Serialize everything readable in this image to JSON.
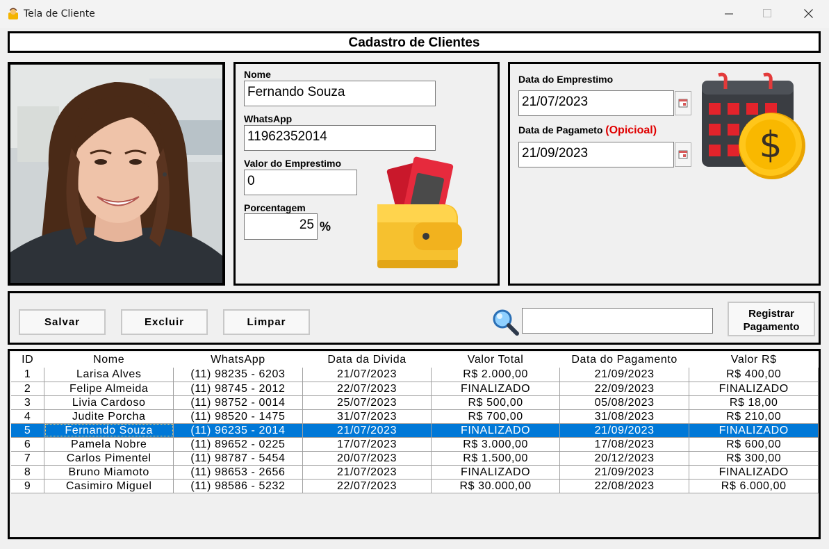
{
  "window": {
    "title": "Tela de Cliente"
  },
  "header": {
    "title": "Cadastro de Clientes"
  },
  "form": {
    "nome_label": "Nome",
    "nome_value": "Fernando Souza",
    "whatsapp_label": "WhatsApp",
    "whatsapp_value": "11962352014",
    "valor_label": "Valor do Emprestimo",
    "valor_value": "0",
    "porcentagem_label": "Porcentagem",
    "porcentagem_value": "25",
    "percent_sign": "%"
  },
  "dates": {
    "emprestimo_label": "Data do Emprestimo",
    "emprestimo_value": "21/07/2023",
    "pagamento_label": "Data de Pagameto",
    "pagamento_optional": "(Opicioal)",
    "pagamento_value": "21/09/2023"
  },
  "toolbar": {
    "salvar": "Salvar",
    "excluir": "Excluir",
    "limpar": "Limpar",
    "search_value": "",
    "registrar_line1": "Registrar",
    "registrar_line2": "Pagamento"
  },
  "table": {
    "columns": [
      "ID",
      "Nome",
      "WhatsApp",
      "Data da Divida",
      "Valor Total",
      "Data do Pagamento",
      "Valor R$"
    ],
    "selected_index": 4,
    "rows": [
      [
        "1",
        "Larisa Alves",
        "(11) 98235 - 6203",
        "21/07/2023",
        "R$ 2.000,00",
        "21/09/2023",
        "R$ 400,00"
      ],
      [
        "2",
        "Felipe Almeida",
        "(11) 98745 - 2012",
        "22/07/2023",
        "FINALIZADO",
        "22/09/2023",
        "FINALIZADO"
      ],
      [
        "3",
        "Livia Cardoso",
        "(11) 98752 - 0014",
        "25/07/2023",
        "R$ 500,00",
        "05/08/2023",
        "R$ 18,00"
      ],
      [
        "4",
        "Judite Porcha",
        "(11) 98520 - 1475",
        "31/07/2023",
        "R$ 700,00",
        "31/08/2023",
        "R$ 210,00"
      ],
      [
        "5",
        "Fernando Souza",
        "(11) 96235 - 2014",
        "21/07/2023",
        "FINALIZADO",
        "21/09/2023",
        "FINALIZADO"
      ],
      [
        "6",
        "Pamela Nobre",
        "(11) 89652 - 0225",
        "17/07/2023",
        "R$ 3.000,00",
        "17/08/2023",
        "R$ 600,00"
      ],
      [
        "7",
        "Carlos Pimentel",
        "(11) 98787 - 5454",
        "20/07/2023",
        "R$ 1.500,00",
        "20/12/2023",
        "R$ 300,00"
      ],
      [
        "8",
        "Bruno Miamoto",
        "(11) 98653 - 2656",
        "21/07/2023",
        "FINALIZADO",
        "21/09/2023",
        "FINALIZADO"
      ],
      [
        "9",
        "Casimiro Miguel",
        "(11) 98586 - 5232",
        "22/07/2023",
        "R$ 30.000,00",
        "22/08/2023",
        "R$ 6.000,00"
      ]
    ]
  },
  "icons": {
    "app": "person-icon",
    "wallet": "wallet-icon",
    "calendar": "calendar-dollar-icon",
    "search": "magnifier-icon"
  },
  "colors": {
    "selection": "#0078d7",
    "optional_text": "#e00000"
  }
}
